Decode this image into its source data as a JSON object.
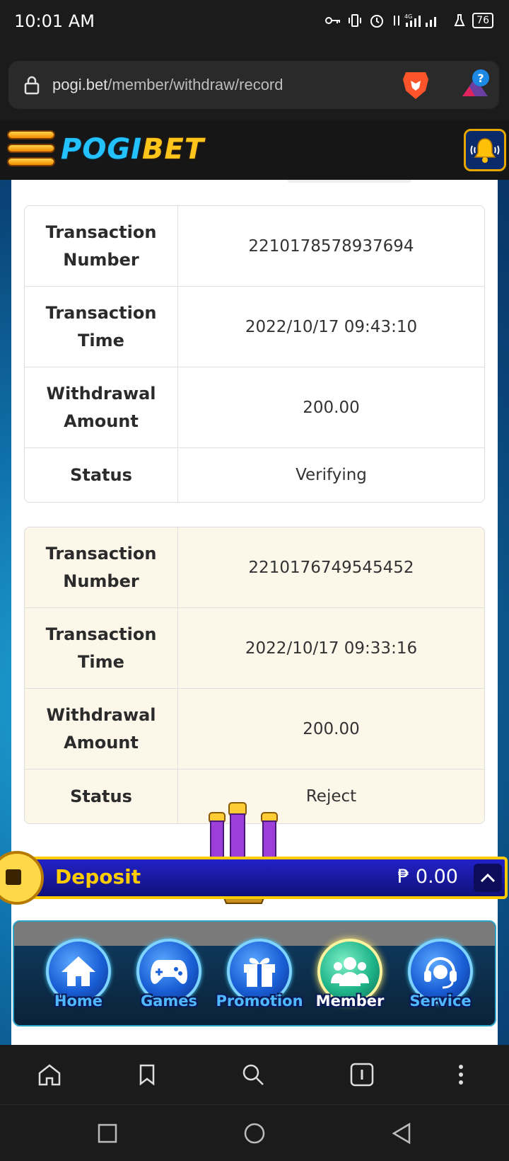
{
  "status_bar": {
    "time": "10:01 AM",
    "battery": "76",
    "network": "4G"
  },
  "browser": {
    "url_host": "pogi.bet",
    "url_path": "/member/withdraw/record"
  },
  "site": {
    "logo_part1": "POGI",
    "logo_part2": "BET"
  },
  "records": [
    {
      "label_number": "Transaction Number",
      "number": "2210178578937694",
      "label_time": "Transaction Time",
      "time": "2022/10/17 09:43:10",
      "label_amount": "Withdrawal Amount",
      "amount": "200.00",
      "label_status": "Status",
      "status": "Verifying"
    },
    {
      "label_number": "Transaction Number",
      "number": "2210176749545452",
      "label_time": "Transaction Time",
      "time": "2022/10/17 09:33:16",
      "label_amount": "Withdrawal Amount",
      "amount": "200.00",
      "label_status": "Status",
      "status": "Reject"
    }
  ],
  "deposit": {
    "label": "Deposit",
    "amount": "₱ 0.00"
  },
  "nav": {
    "items": [
      {
        "label": "Home",
        "icon": "home-icon"
      },
      {
        "label": "Games",
        "icon": "gamepad-icon"
      },
      {
        "label": "Promotion",
        "icon": "gift-icon"
      },
      {
        "label": "Member",
        "icon": "members-icon",
        "active": true
      },
      {
        "label": "Service",
        "icon": "headset-icon"
      }
    ]
  },
  "colors": {
    "accent_gold": "#ffcc00",
    "deposit_blue": "#1a1ab0",
    "nav_blue": "#4fb8ff",
    "record_alt_bg": "#fdf7ea"
  }
}
